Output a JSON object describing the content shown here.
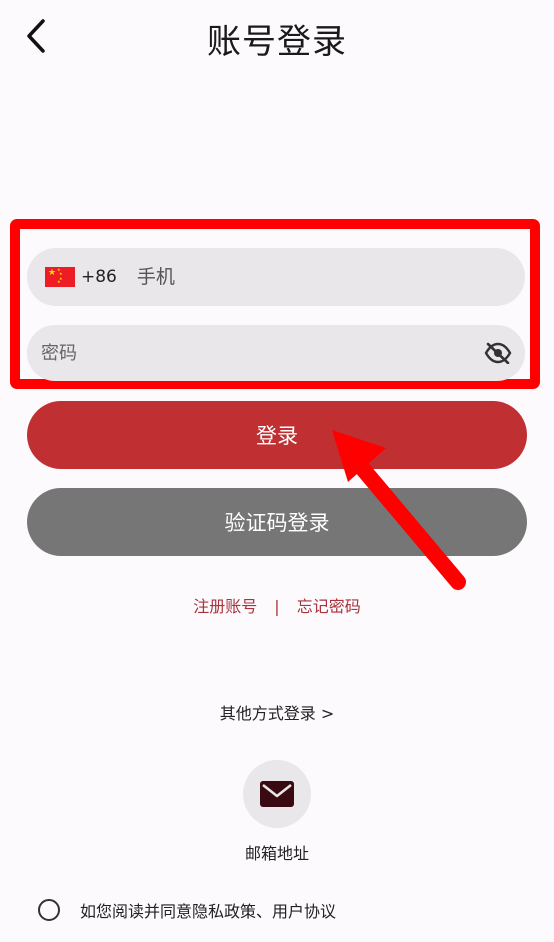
{
  "header": {
    "title": "账号登录"
  },
  "phone": {
    "country_code": "+86",
    "placeholder": "手机"
  },
  "password": {
    "placeholder": "密码"
  },
  "buttons": {
    "login": "登录",
    "code_login": "验证码登录"
  },
  "links": {
    "register": "注册账号",
    "separator": "|",
    "forgot": "忘记密码"
  },
  "other_login": {
    "label": "其他方式登录 >"
  },
  "email_login": {
    "label": "邮箱地址",
    "icon": "mail-icon"
  },
  "agreement": {
    "text": "如您阅读并同意隐私政策、用户协议",
    "checked": false
  },
  "colors": {
    "primary": "#c02f32",
    "secondary": "#767676",
    "link": "#a8333a",
    "annotation": "#ff0000",
    "field_bg": "#e9e7e9"
  }
}
